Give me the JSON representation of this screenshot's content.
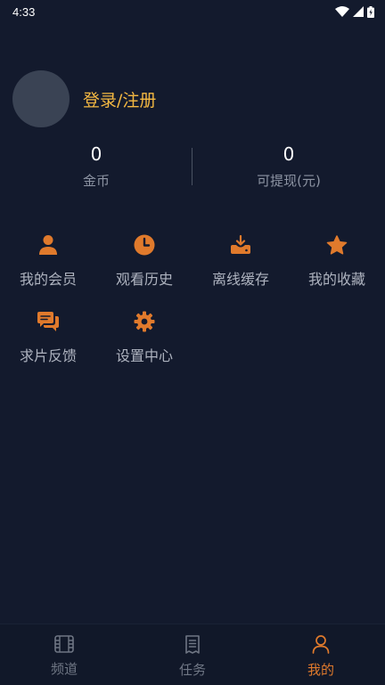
{
  "status_bar": {
    "time": "4:33",
    "icons": [
      "wifi-icon",
      "signal-icon",
      "battery-icon"
    ]
  },
  "profile": {
    "login_label": "登录/注册"
  },
  "stats": {
    "coins": {
      "value": "0",
      "label": "金币"
    },
    "withdrawable": {
      "value": "0",
      "label": "可提现(元)"
    }
  },
  "menu": {
    "items": [
      {
        "label": "我的会员",
        "icon": "member-icon"
      },
      {
        "label": "观看历史",
        "icon": "history-clock-icon"
      },
      {
        "label": "离线缓存",
        "icon": "download-cache-icon"
      },
      {
        "label": "我的收藏",
        "icon": "star-icon"
      },
      {
        "label": "求片反馈",
        "icon": "chat-feedback-icon"
      },
      {
        "label": "设置中心",
        "icon": "gear-icon"
      }
    ]
  },
  "tabbar": {
    "tabs": [
      {
        "label": "频道",
        "icon": "film-icon",
        "active": false
      },
      {
        "label": "任务",
        "icon": "task-list-icon",
        "active": false
      },
      {
        "label": "我的",
        "icon": "user-icon",
        "active": true
      }
    ]
  },
  "colors": {
    "background": "#131a2d",
    "accent": "#e07a2c",
    "login_text": "#f5b942",
    "muted_text": "#8d94a3"
  }
}
